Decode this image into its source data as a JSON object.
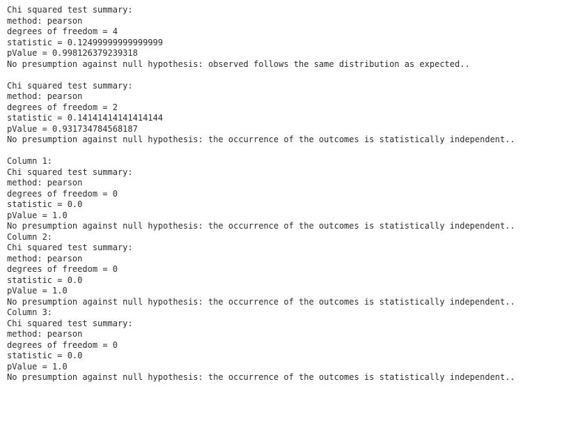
{
  "console": {
    "font_color": "#2b2b2b",
    "background_color": "#ffffff",
    "lines": [
      "Chi squared test summary:",
      "method: pearson",
      "degrees of freedom = 4",
      "statistic = 0.12499999999999999",
      "pValue = 0.998126379239318",
      "No presumption against null hypothesis: observed follows the same distribution as expected..",
      "",
      "Chi squared test summary:",
      "method: pearson",
      "degrees of freedom = 2",
      "statistic = 0.14141414141414144",
      "pValue = 0.931734784568187",
      "No presumption against null hypothesis: the occurrence of the outcomes is statistically independent..",
      "",
      "Column 1:",
      "Chi squared test summary:",
      "method: pearson",
      "degrees of freedom = 0",
      "statistic = 0.0",
      "pValue = 1.0",
      "No presumption against null hypothesis: the occurrence of the outcomes is statistically independent..",
      "Column 2:",
      "Chi squared test summary:",
      "method: pearson",
      "degrees of freedom = 0",
      "statistic = 0.0",
      "pValue = 1.0",
      "No presumption against null hypothesis: the occurrence of the outcomes is statistically independent..",
      "Column 3:",
      "Chi squared test summary:",
      "method: pearson",
      "degrees of freedom = 0",
      "statistic = 0.0",
      "pValue = 1.0",
      "No presumption against null hypothesis: the occurrence of the outcomes is statistically independent.."
    ],
    "blocks": [
      {
        "header": null,
        "title": "Chi squared test summary:",
        "method_label": "method:",
        "method": "pearson",
        "degrees_of_freedom_label": "degrees of freedom =",
        "degrees_of_freedom": "4",
        "statistic_label": "statistic =",
        "statistic": "0.12499999999999999",
        "pvalue_label": "pValue =",
        "pvalue": "0.998126379239318",
        "conclusion": "No presumption against null hypothesis: observed follows the same distribution as expected.."
      },
      {
        "header": null,
        "title": "Chi squared test summary:",
        "method_label": "method:",
        "method": "pearson",
        "degrees_of_freedom_label": "degrees of freedom =",
        "degrees_of_freedom": "2",
        "statistic_label": "statistic =",
        "statistic": "0.14141414141414144",
        "pvalue_label": "pValue =",
        "pvalue": "0.931734784568187",
        "conclusion": "No presumption against null hypothesis: the occurrence of the outcomes is statistically independent.."
      },
      {
        "header": "Column 1:",
        "title": "Chi squared test summary:",
        "method_label": "method:",
        "method": "pearson",
        "degrees_of_freedom_label": "degrees of freedom =",
        "degrees_of_freedom": "0",
        "statistic_label": "statistic =",
        "statistic": "0.0",
        "pvalue_label": "pValue =",
        "pvalue": "1.0",
        "conclusion": "No presumption against null hypothesis: the occurrence of the outcomes is statistically independent.."
      },
      {
        "header": "Column 2:",
        "title": "Chi squared test summary:",
        "method_label": "method:",
        "method": "pearson",
        "degrees_of_freedom_label": "degrees of freedom =",
        "degrees_of_freedom": "0",
        "statistic_label": "statistic =",
        "statistic": "0.0",
        "pvalue_label": "pValue =",
        "pvalue": "1.0",
        "conclusion": "No presumption against null hypothesis: the occurrence of the outcomes is statistically independent.."
      },
      {
        "header": "Column 3:",
        "title": "Chi squared test summary:",
        "method_label": "method:",
        "method": "pearson",
        "degrees_of_freedom_label": "degrees of freedom =",
        "degrees_of_freedom": "0",
        "statistic_label": "statistic =",
        "statistic": "0.0",
        "pvalue_label": "pValue =",
        "pvalue": "1.0",
        "conclusion": "No presumption against null hypothesis: the occurrence of the outcomes is statistically independent.."
      }
    ]
  }
}
